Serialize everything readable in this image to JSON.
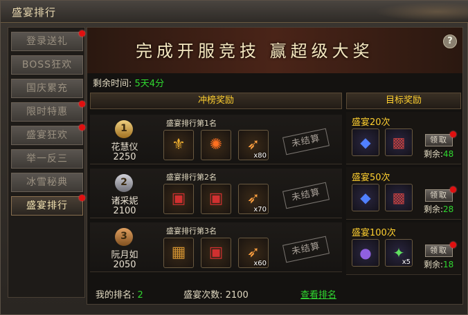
{
  "window": {
    "title": "盛宴排行"
  },
  "sidebar": {
    "items": [
      {
        "label": "登录送礼",
        "dot": true
      },
      {
        "label": "BOSS狂欢",
        "dot": false
      },
      {
        "label": "国庆累充",
        "dot": false
      },
      {
        "label": "限时特惠",
        "dot": true
      },
      {
        "label": "盛宴狂欢",
        "dot": true
      },
      {
        "label": "举一反三",
        "dot": false
      },
      {
        "label": "冰雪秘典",
        "dot": false
      },
      {
        "label": "盛宴排行",
        "dot": true,
        "active": true
      }
    ]
  },
  "banner": {
    "text": "完成开服竞技  赢超级大奖",
    "help": "?"
  },
  "remain": {
    "label": "剩余时间:",
    "value": "5天4分"
  },
  "rank_header": "冲榜奖励",
  "target_header": "目标奖励",
  "rank_rows": [
    {
      "rank": "1",
      "name": "花慧仪",
      "score": "2250",
      "label": "盛宴排行第1名",
      "stamp": "未结算",
      "items": [
        {
          "icon": "gold-armor-icon",
          "count": ""
        },
        {
          "icon": "fire-orb-icon",
          "count": ""
        },
        {
          "icon": "feather-icon",
          "count": "x80"
        }
      ]
    },
    {
      "rank": "2",
      "name": "诸采妮",
      "score": "2100",
      "label": "盛宴排行第2名",
      "stamp": "未结算",
      "items": [
        {
          "icon": "red-chest-icon",
          "count": ""
        },
        {
          "icon": "red-chest-icon",
          "count": ""
        },
        {
          "icon": "feather-icon",
          "count": "x70"
        }
      ]
    },
    {
      "rank": "3",
      "name": "阮月如",
      "score": "2050",
      "label": "盛宴排行第3名",
      "stamp": "未结算",
      "items": [
        {
          "icon": "gold-chest-icon",
          "count": ""
        },
        {
          "icon": "red-chest-icon",
          "count": ""
        },
        {
          "icon": "feather-icon",
          "count": "x60"
        }
      ]
    }
  ],
  "targets": [
    {
      "title": "盛宴20次",
      "button": "领取",
      "left_label": "剩余:",
      "left_value": "48",
      "items": [
        {
          "icon": "blue-gem-icon",
          "count": ""
        },
        {
          "icon": "treasure-chest-icon",
          "count": ""
        }
      ]
    },
    {
      "title": "盛宴50次",
      "button": "领取",
      "left_label": "剩余:",
      "left_value": "28",
      "items": [
        {
          "icon": "blue-gem-icon",
          "count": ""
        },
        {
          "icon": "treasure-chest-icon",
          "count": ""
        }
      ]
    },
    {
      "title": "盛宴100次",
      "button": "领取",
      "left_label": "剩余:",
      "left_value": "18",
      "items": [
        {
          "icon": "purple-orb-icon",
          "count": ""
        },
        {
          "icon": "green-crystal-icon",
          "count": "x5"
        }
      ]
    }
  ],
  "footer": {
    "my_rank_label": "我的排名:",
    "my_rank": "2",
    "count_label": "盛宴次数:",
    "count": "2100",
    "view_rank": "查看排名"
  },
  "colors": {
    "accent_yellow": "#ffd030",
    "green": "#30d830",
    "red_dot": "#e01010"
  }
}
